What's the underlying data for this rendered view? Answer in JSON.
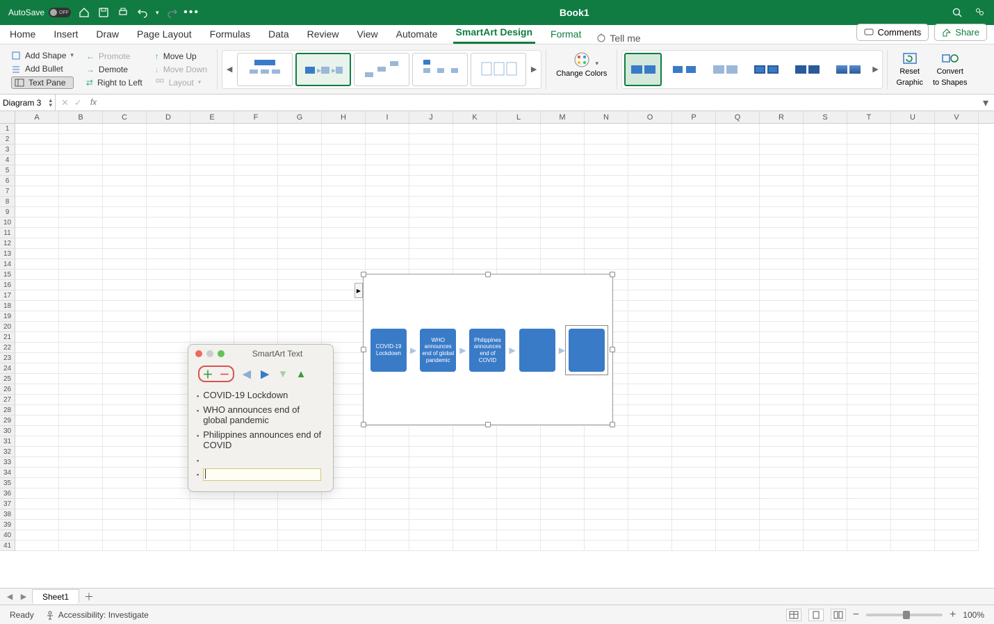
{
  "titlebar": {
    "autosave_label": "AutoSave",
    "autosave_state": "OFF",
    "doc_title": "Book1"
  },
  "tabs": {
    "home": "Home",
    "insert": "Insert",
    "draw": "Draw",
    "page_layout": "Page Layout",
    "formulas": "Formulas",
    "data": "Data",
    "review": "Review",
    "view": "View",
    "automate": "Automate",
    "smartart_design": "SmartArt Design",
    "format": "Format",
    "tellme": "Tell me",
    "comments": "Comments",
    "share": "Share"
  },
  "ribbon": {
    "add_shape": "Add Shape",
    "add_bullet": "Add Bullet",
    "text_pane": "Text Pane",
    "promote": "Promote",
    "demote": "Demote",
    "rtl": "Right to Left",
    "move_up": "Move Up",
    "move_down": "Move Down",
    "layout": "Layout",
    "change_colors": "Change Colors",
    "reset_graphic_l1": "Reset",
    "reset_graphic_l2": "Graphic",
    "convert_l1": "Convert",
    "convert_l2": "to Shapes"
  },
  "namebox": "Diagram 3",
  "fx": "fx",
  "columns": [
    "A",
    "B",
    "C",
    "D",
    "E",
    "F",
    "G",
    "H",
    "I",
    "J",
    "K",
    "L",
    "M",
    "N",
    "O",
    "P",
    "Q",
    "R",
    "S",
    "T",
    "U",
    "V"
  ],
  "smartart": {
    "box1": "COVID-19 Lockdown",
    "box2": "WHO announces end of global pandemic",
    "box3": "Philippines announces end of COVID",
    "box4": "",
    "box5": ""
  },
  "textpane": {
    "title": "SmartArt Text",
    "item1": "COVID-19 Lockdown",
    "item2": "WHO announces end of global pandemic",
    "item3": "Philippines announces end of COVID",
    "item4": "",
    "item5": ""
  },
  "sheet": {
    "tab1": "Sheet1"
  },
  "status": {
    "ready": "Ready",
    "accessibility": "Accessibility: Investigate",
    "zoom": "100%"
  }
}
